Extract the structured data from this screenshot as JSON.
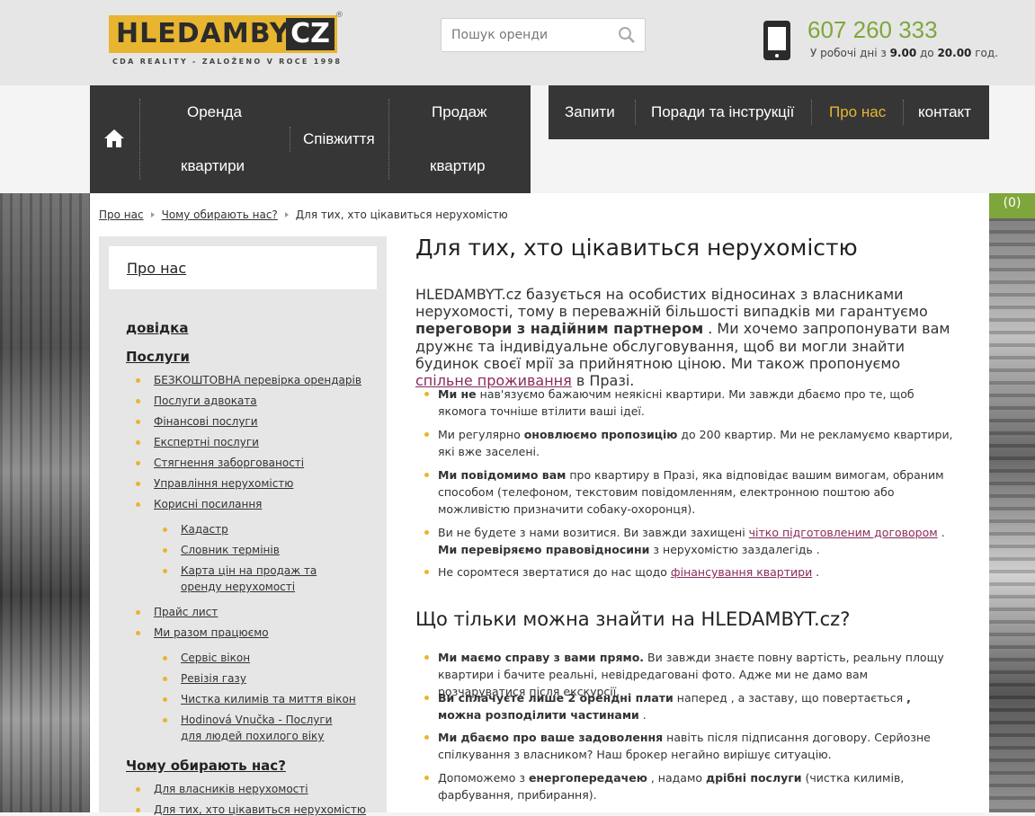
{
  "header": {
    "logo_text": "HLEDAMBYT",
    "logo_cz": "CZ",
    "logo_reg": "®",
    "logo_tagline": "CDA REALITY - ZALOŽENO V ROCE 1998",
    "search_placeholder": "Пошук оренди",
    "phone": "607 260 333",
    "hours_pre": "У робочі дні з ",
    "hours_from": "9.00",
    "hours_mid": " до ",
    "hours_to": "20.00",
    "hours_post": " год."
  },
  "nav": {
    "rent_line1": "Оренда",
    "rent_line2": "квартири",
    "cohab": "Співжиття",
    "sale_line1": "Продаж",
    "sale_line2": "квартир",
    "requests": "Запити",
    "tips": "Поради та інструкції",
    "about": "Про нас",
    "contact": "контакт"
  },
  "cart_count": "(0)",
  "colors": {
    "accent_green": "#7ea73b",
    "accent_yellow": "#e8b531",
    "nav_bg": "#363636",
    "active_nav": "#e8b531"
  },
  "breadcrumb": [
    "Про нас",
    "Чому обирають нас?",
    "Для тих, хто цікавиться нерухомістю"
  ],
  "sidebar": {
    "heading": "Про нас",
    "items": [
      "довідка",
      "Послуги",
      "БЕЗКОШТОВНА перевірка орендарів",
      "Послуги адвоката",
      "Фінансові послуги",
      "Експертні послуги",
      "Стягнення заборгованості",
      "Управління нерухомістю",
      "Корисні посилання",
      "Кадастр",
      "Словник термінів",
      "Карта цін на продаж та",
      "оренду нерухомості",
      "Прайс лист",
      "Ми разом працюємо",
      "Сервіс вікон",
      "Ревізія газу",
      "Чистка килимів та миття вікон",
      "Hodinová Vnučka - Послуги",
      "для людей похилого віку",
      "Чому обирають нас?",
      "Для власників нерухомості",
      "Для тих, хто цікавиться нерухомістю"
    ]
  },
  "content": {
    "title": "Для тих, хто цікавиться нерухомістю",
    "intro_1": "HLEDAMBYT.cz базується на особистих відносинах з власниками нерухомості, тому в переважній більшості випадків ми гарантуємо ",
    "intro_bold": "переговори з надійним партнером",
    "intro_2": " . Ми хочемо запропонувати вам дружнє та індивідуальне обслуговування, щоб ви могли знайти будинок своєї мрії за прийнятною ціною. Ми також пропонуємо ",
    "intro_link": "спільне проживання",
    "intro_3": " в Празі.",
    "b1_bold": "Ми не",
    "b1_text": " нав'язуємо бажаючим неякісні квартири. Ми завжди дбаємо про те, щоб якомога точніше втілити ваші ідеї.",
    "b2_text1": "Ми регулярно ",
    "b2_bold": "оновлюємо пропозицію",
    "b2_text2": " до 200 квартир. Ми не рекламуємо квартири, які вже заселені.",
    "b3_bold": "Ми повідомимо вам",
    "b3_text": " про квартиру в Празі, яка відповідає вашим вимогам, обраним способом (телефоном, текстовим повідомленням, електронною поштою або можливістю призначити собаку-охоронця).",
    "b4_text1": "Ви не будете з нами возитися. Ви завжди захищені ",
    "b4_link": "чітко підготовленим договором",
    "b4_text2": " . ",
    "b4_bold": "Ми перевіряємо правовідносини",
    "b4_text3": " з нерухомістю заздалегідь .",
    "b5_text1": "Не соромтеся звертатися до нас щодо ",
    "b5_link": "фінансування квартири",
    "b5_text2": " .",
    "subtitle": "Що тільки можна знайти на HLEDAMBYT.cz?",
    "c1_bold": "Ми маємо справу з вами прямо.",
    "c1_text": " Ви завжди знаєте повну вартість, реальну площу квартири і бачите реальні, невідредаговані фото. Адже ми не дамо вам розчаруватися після екскурсії.",
    "c2_bold1": "Ви сплачуєте лише 2 орендні плати",
    "c2_text1": " наперед , а заставу, що повертається ",
    "c2_bold2": ", можна розподілити частинами",
    "c2_text2": " .",
    "c3_bold": "Ми дбаємо про ваше задоволення",
    "c3_text": " навіть після підписання договору. Серйозне спілкування з власником? Наш брокер негайно вирішує ситуацію.",
    "c4_text1": "Допоможемо з ",
    "c4_bold1": "енергопередачею",
    "c4_text2": " , надамо ",
    "c4_bold2": "дрібні послуги",
    "c4_text3": " (чистка килимів, фарбування, прибирання)."
  }
}
